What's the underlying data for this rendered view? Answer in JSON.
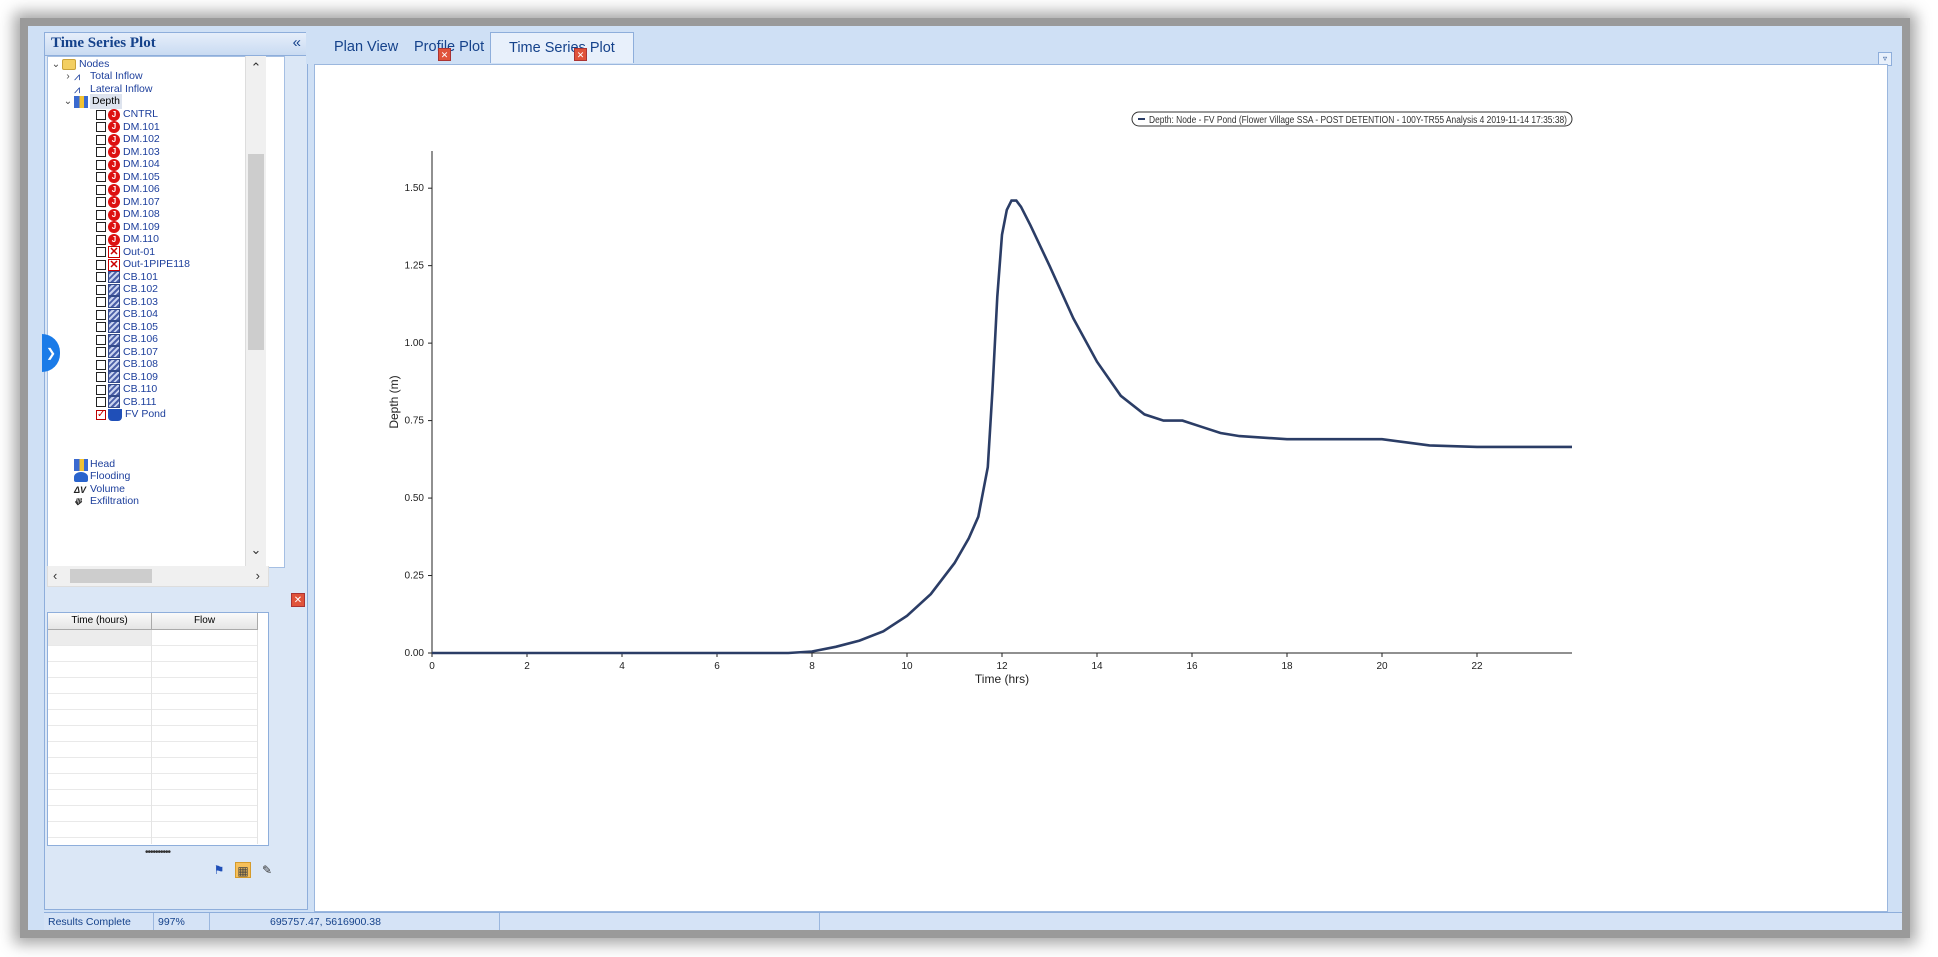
{
  "panel": {
    "title": "Time Series Plot",
    "collapse_glyph": "«"
  },
  "tree": {
    "root": "Nodes",
    "top_items": [
      "Total Inflow",
      "Lateral Inflow",
      "Depth"
    ],
    "nodes": [
      {
        "label": "CNTRL",
        "type": "junction",
        "checked": false
      },
      {
        "label": "DM.101",
        "type": "junction",
        "checked": false
      },
      {
        "label": "DM.102",
        "type": "junction",
        "checked": false
      },
      {
        "label": "DM.103",
        "type": "junction",
        "checked": false
      },
      {
        "label": "DM.104",
        "type": "junction",
        "checked": false
      },
      {
        "label": "DM.105",
        "type": "junction",
        "checked": false
      },
      {
        "label": "DM.106",
        "type": "junction",
        "checked": false
      },
      {
        "label": "DM.107",
        "type": "junction",
        "checked": false
      },
      {
        "label": "DM.108",
        "type": "junction",
        "checked": false
      },
      {
        "label": "DM.109",
        "type": "junction",
        "checked": false
      },
      {
        "label": "DM.110",
        "type": "junction",
        "checked": false
      },
      {
        "label": "Out-01",
        "type": "outfall",
        "checked": false
      },
      {
        "label": "Out-1PIPE118",
        "type": "outfall",
        "checked": false
      },
      {
        "label": "CB.101",
        "type": "catchbasin",
        "checked": false
      },
      {
        "label": "CB.102",
        "type": "catchbasin",
        "checked": false
      },
      {
        "label": "CB.103",
        "type": "catchbasin",
        "checked": false
      },
      {
        "label": "CB.104",
        "type": "catchbasin",
        "checked": false
      },
      {
        "label": "CB.105",
        "type": "catchbasin",
        "checked": false
      },
      {
        "label": "CB.106",
        "type": "catchbasin",
        "checked": false
      },
      {
        "label": "CB.107",
        "type": "catchbasin",
        "checked": false
      },
      {
        "label": "CB.108",
        "type": "catchbasin",
        "checked": false
      },
      {
        "label": "CB.109",
        "type": "catchbasin",
        "checked": false
      },
      {
        "label": "CB.110",
        "type": "catchbasin",
        "checked": false
      },
      {
        "label": "CB.111",
        "type": "catchbasin",
        "checked": false
      },
      {
        "label": "FV Pond",
        "type": "pond",
        "checked": true
      }
    ],
    "bottom_items": [
      "Head",
      "Flooding",
      "Volume",
      "Exfiltration"
    ]
  },
  "grid": {
    "columns": [
      "Time (hours)",
      "Flow"
    ]
  },
  "tabs": [
    {
      "label": "Plan View"
    },
    {
      "label": "Profile Plot"
    },
    {
      "label": "Time Series Plot",
      "active": true
    }
  ],
  "status": {
    "state": "Results Complete",
    "zoom": "997%",
    "coords": "695757.47, 5616900.38"
  },
  "chart_data": {
    "type": "line",
    "title": "",
    "xlabel": "Time (hrs)",
    "ylabel": "Depth (m)",
    "xlim": [
      0,
      24
    ],
    "ylim": [
      0,
      1.62
    ],
    "xticks": [
      0,
      2,
      4,
      6,
      8,
      10,
      12,
      14,
      16,
      18,
      20,
      22
    ],
    "yticks": [
      0.0,
      0.25,
      0.5,
      0.75,
      1.0,
      1.25,
      1.5
    ],
    "grid": false,
    "legend_position": "top-right",
    "series": [
      {
        "name": "Depth: Node - FV Pond (Flower Village SSA - POST DETENTION - 100Y-TR55 Analysis 4 2019-11-14 17:35:38)",
        "color": "#2b3d66",
        "x": [
          0,
          7.5,
          8.0,
          8.5,
          9.0,
          9.5,
          10.0,
          10.5,
          11.0,
          11.3,
          11.5,
          11.7,
          11.8,
          11.9,
          12.0,
          12.1,
          12.2,
          12.3,
          12.4,
          12.6,
          13.0,
          13.5,
          14.0,
          14.5,
          15.0,
          15.4,
          15.8,
          16.2,
          16.6,
          17.0,
          18.0,
          19.0,
          20.0,
          20.5,
          21.0,
          22.0,
          23.0,
          24.0
        ],
        "y": [
          0,
          0,
          0.005,
          0.02,
          0.04,
          0.07,
          0.12,
          0.19,
          0.29,
          0.37,
          0.44,
          0.6,
          0.85,
          1.15,
          1.35,
          1.43,
          1.46,
          1.46,
          1.44,
          1.38,
          1.25,
          1.08,
          0.94,
          0.83,
          0.77,
          0.75,
          0.75,
          0.73,
          0.71,
          0.7,
          0.69,
          0.69,
          0.69,
          0.68,
          0.67,
          0.665,
          0.665,
          0.665
        ]
      }
    ]
  },
  "colors": {
    "series": "#2b3d66",
    "panel_header": "#15428b",
    "tab_background": "#cfe0f5",
    "close_button": "#e0533a"
  }
}
